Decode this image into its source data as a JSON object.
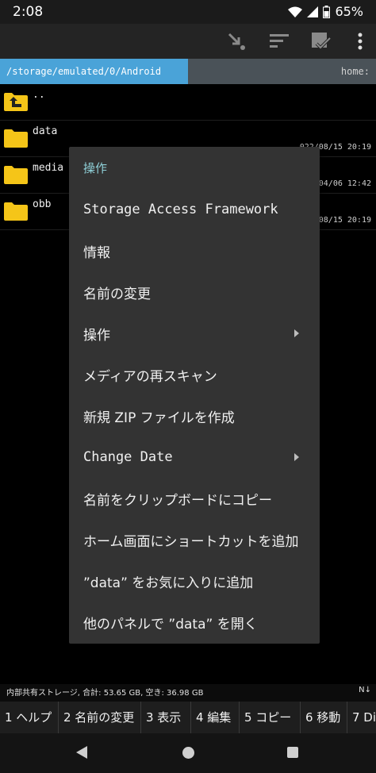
{
  "status": {
    "time": "2:08",
    "battery": "65%"
  },
  "toolbar": {
    "icons": [
      "mark-icon",
      "sort-icon",
      "select-icon",
      "more-icon"
    ]
  },
  "pathbar": {
    "current": "/storage/emulated/0/Android",
    "home": "home:"
  },
  "files": [
    {
      "name": "..",
      "date": ""
    },
    {
      "name": "data",
      "date": "022/08/15 20:19"
    },
    {
      "name": "media",
      "date": "22/04/06 12:42"
    },
    {
      "name": "obb",
      "date": "022/08/15 20:19"
    }
  ],
  "menu": {
    "title": "操作",
    "items": [
      {
        "label": "Storage Access Framework",
        "submenu": false
      },
      {
        "label": "情報",
        "submenu": false
      },
      {
        "label": "名前の変更",
        "submenu": false
      },
      {
        "label": "操作",
        "submenu": true
      },
      {
        "label": "メディアの再スキャン",
        "submenu": false
      },
      {
        "label": "新規 ZIP ファイルを作成",
        "submenu": false
      },
      {
        "label": "Change Date",
        "submenu": true
      },
      {
        "label": "名前をクリップボードにコピー",
        "submenu": false
      },
      {
        "label": "ホーム画面にショートカットを追加",
        "submenu": false
      },
      {
        "label": "”data” をお気に入りに追加",
        "submenu": false
      },
      {
        "label": "他のパネルで ”data” を開く",
        "submenu": false
      }
    ]
  },
  "storage": {
    "text": "内部共有ストレージ, 合計: 53.65 GB, 空き: 36.98 GB",
    "right": "N↓"
  },
  "fkeys": [
    "1 ヘルプ",
    "2 名前の変更",
    "3 表示",
    "4 編集",
    "5 コピー",
    "6 移動",
    "7 Di"
  ],
  "colors": {
    "accent": "#4aa3d8",
    "folder": "#f5c518",
    "menu_bg": "#333333",
    "menu_title": "#8fd0d8"
  }
}
